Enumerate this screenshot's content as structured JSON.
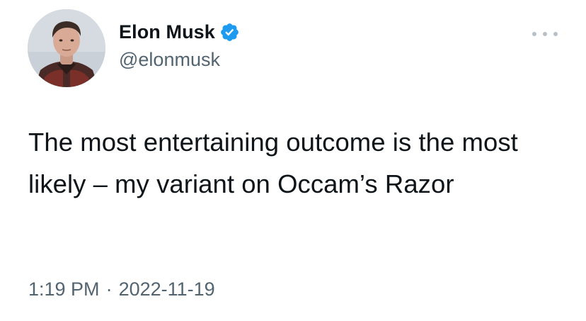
{
  "author": {
    "display_name": "Elon Musk",
    "handle": "@elonmusk",
    "verified": true,
    "avatar_icon": "profile-photo",
    "verified_icon": "verified-badge-icon"
  },
  "tweet": {
    "text": "The most entertaining outcome is the most likely – my variant on Occam’s Razor"
  },
  "meta": {
    "time": "1:19 PM",
    "separator": "·",
    "date": "2022-11-19"
  },
  "colors": {
    "text_primary": "#0f1419",
    "text_secondary": "#536471",
    "verified_blue": "#1d9bf0",
    "more_dots": "#b9c0c6"
  },
  "more_menu_icon": "more-horizontal-icon"
}
